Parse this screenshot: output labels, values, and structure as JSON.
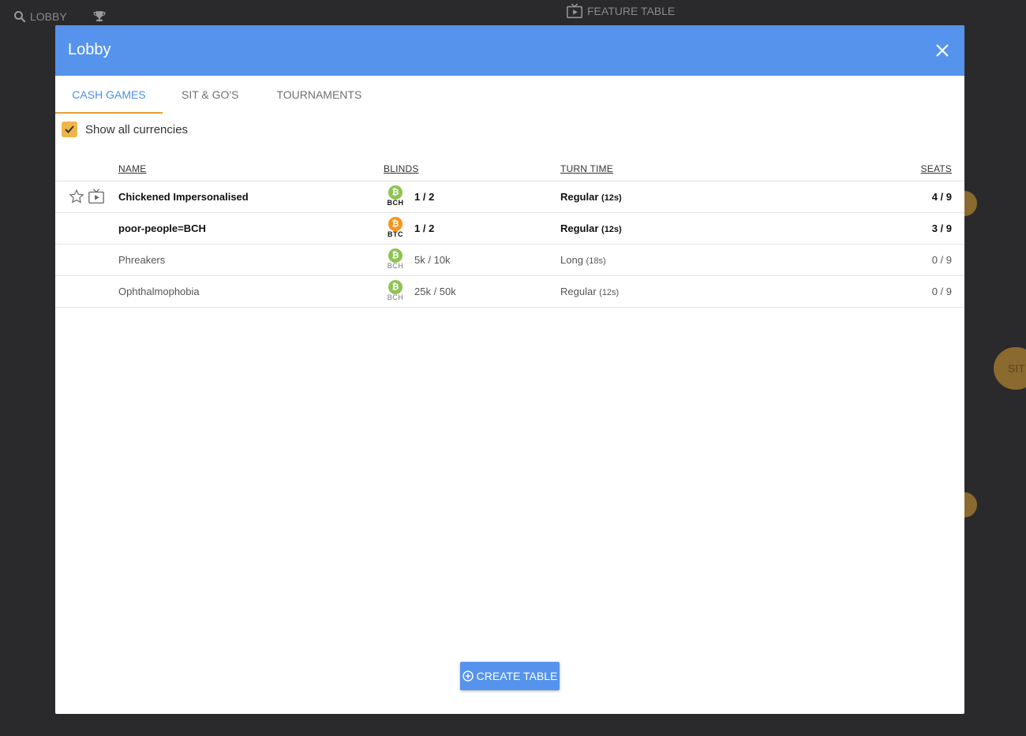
{
  "topnav": {
    "lobby_label": "LOBBY",
    "feature_label": "FEATURE TABLE",
    "circle_text": "SIT"
  },
  "modal": {
    "title": "Lobby",
    "tabs": [
      {
        "label": "CASH GAMES",
        "active": true
      },
      {
        "label": "SIT & GO'S",
        "active": false
      },
      {
        "label": "TOURNAMENTS",
        "active": false
      }
    ],
    "show_all_currencies": {
      "label": "Show all currencies",
      "checked": true
    },
    "columns": {
      "name": "NAME",
      "blinds": "BLINDS",
      "turn_time": "TURN TIME",
      "seats": "SEATS"
    },
    "rows": [
      {
        "name": "Chickened Impersonalised",
        "currency": "BCH",
        "blinds": "1 / 2",
        "turn": "Regular",
        "turn_secs": "(12s)",
        "seats": "4 / 9"
      },
      {
        "name": "poor-people=BCH",
        "currency": "BTC",
        "blinds": "1 / 2",
        "turn": "Regular",
        "turn_secs": "(12s)",
        "seats": "3 / 9"
      },
      {
        "name": "Phreakers",
        "currency": "BCH",
        "blinds": "5k / 10k",
        "turn": "Long",
        "turn_secs": "(18s)",
        "seats": "0 / 9"
      },
      {
        "name": "Ophthalmophobia",
        "currency": "BCH",
        "blinds": "25k / 50k",
        "turn": "Regular",
        "turn_secs": "(12s)",
        "seats": "0 / 9"
      }
    ],
    "create_label": "CREATE TABLE",
    "colors": {
      "header": "#5593ec",
      "accent_tab": "#e5a03a",
      "bch": "#8dc451",
      "btc": "#f7931a"
    }
  }
}
